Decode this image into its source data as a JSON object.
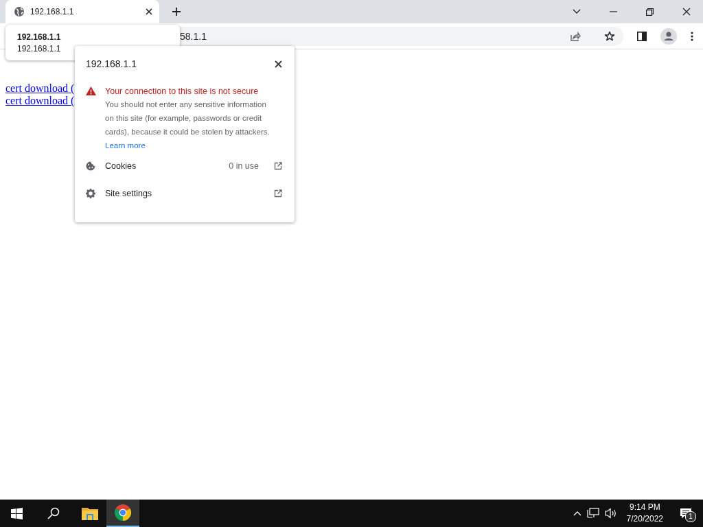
{
  "tabs": [
    {
      "title": "192.168.1.1",
      "selected": true
    }
  ],
  "tab_tooltip": {
    "title": "192.168.1.1",
    "url": "192.168.1.1"
  },
  "address_bar": {
    "value": "58.1.1"
  },
  "page": {
    "links": [
      "cert download (",
      "cert download ("
    ]
  },
  "site_info_popup": {
    "title": "192.168.1.1",
    "warning": "Your connection to this site is not secure",
    "message": "You should not enter any sensitive information on this site (for example, passwords or credit cards), because it could be stolen by attackers.",
    "learn_more": "Learn more",
    "items": [
      {
        "kind": "cookies",
        "label": "Cookies",
        "detail": "0 in use"
      },
      {
        "kind": "settings",
        "label": "Site settings"
      }
    ]
  },
  "taskbar": {
    "apps": [
      {
        "kind": "explorer",
        "active": false
      },
      {
        "kind": "chrome",
        "active": true
      }
    ],
    "time": "9:14 PM",
    "date": "7/20/2022",
    "notifications": "1"
  }
}
